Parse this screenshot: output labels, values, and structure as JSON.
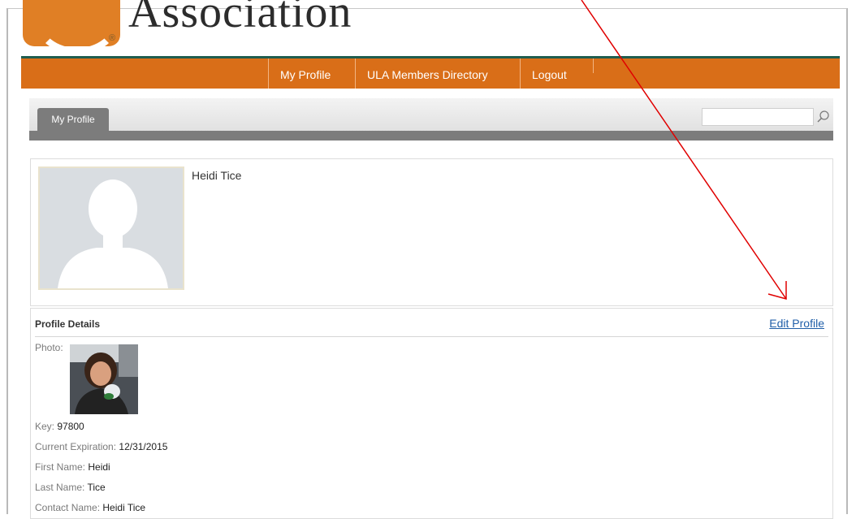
{
  "logo": {
    "text": "Association",
    "registered": "®"
  },
  "nav": {
    "items": [
      {
        "label": "My Profile"
      },
      {
        "label": "ULA Members Directory"
      },
      {
        "label": "Logout"
      }
    ]
  },
  "tabs": {
    "active": "My Profile"
  },
  "search": {
    "placeholder": ""
  },
  "profile": {
    "name": "Heidi Tice"
  },
  "details": {
    "title": "Profile Details",
    "edit_label": "Edit Profile",
    "photo_label": "Photo:",
    "fields": [
      {
        "label": "Key:",
        "value": "97800"
      },
      {
        "label": "Current Expiration:",
        "value": "12/31/2015"
      },
      {
        "label": "First Name:",
        "value": "Heidi"
      },
      {
        "label": "Last Name:",
        "value": "Tice"
      },
      {
        "label": "Contact Name:",
        "value": "Heidi Tice"
      }
    ]
  },
  "colors": {
    "nav_orange": "#d96e18",
    "nav_top_border": "#1f5d4f",
    "link_blue": "#1f5ea8",
    "annotation_red": "#e00000"
  },
  "icons": [
    "search-icon",
    "avatar-placeholder-icon",
    "annotation-arrow"
  ]
}
